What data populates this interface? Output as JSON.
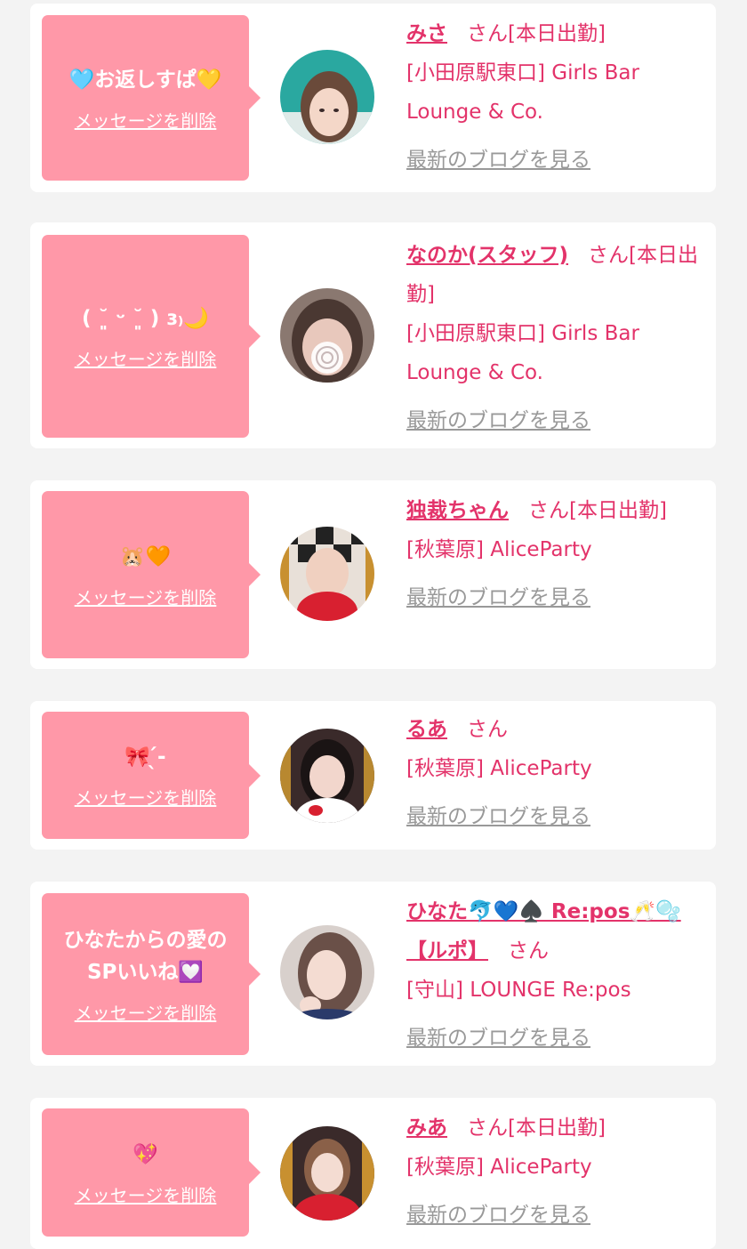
{
  "delete_label": "メッセージを削除",
  "blog_label": "最新のブログを見る",
  "colors": {
    "background": "#f3f3f3",
    "card": "#ffffff",
    "bubble": "#ff98a8",
    "accent_text": "#e3336a",
    "link_gray": "#999999"
  },
  "messages": [
    {
      "text": "🩵お返しすぱ💛",
      "name": "みさ",
      "honorific": "さん",
      "status": "[本日出勤]",
      "shop": "[小田原駅東口] Girls Bar Lounge & Co."
    },
    {
      "text": "( ˘͈ ᵕ ˘͈ ) ɜ₎🌙",
      "name": "なのか(スタッフ)",
      "honorific": "さん",
      "status": "[本日出勤]",
      "shop": "[小田原駅東口] Girls Bar Lounge & Co."
    },
    {
      "text": "🐹🧡",
      "name": "独裁ちゃん",
      "honorific": "さん",
      "status": "[本日出勤]",
      "shop": "[秋葉原] AliceParty"
    },
    {
      "text": "🎀 ̖́-",
      "name": "るあ",
      "honorific": "さん",
      "status": "",
      "shop": "[秋葉原] AliceParty"
    },
    {
      "text": "ひなたからの愛のSPいいね💟",
      "name": "ひなた🐬💙♠️ Re:pos🥂🫧【ルポ】",
      "honorific": "さん",
      "status": "",
      "shop": "[守山] LOUNGE Re:pos"
    },
    {
      "text": "💖",
      "name": "みあ",
      "honorific": "さん",
      "status": "[本日出勤]",
      "shop": "[秋葉原] AliceParty"
    }
  ]
}
